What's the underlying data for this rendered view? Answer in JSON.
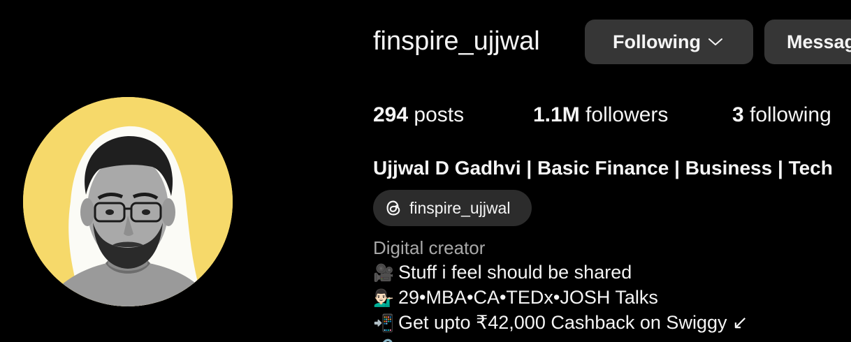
{
  "profile": {
    "username": "finspire_ujjwal",
    "full_name": "Ujjwal D Gadhvi | Basic Finance | Business | Tech",
    "category": "Digital creator"
  },
  "actions": {
    "following_label": "Following",
    "message_label": "Messag"
  },
  "stats": {
    "posts_count": "294",
    "posts_label": "posts",
    "followers_count": "1.1M",
    "followers_label": "followers",
    "following_count": "3",
    "following_label": "following"
  },
  "threads": {
    "handle": "finspire_ujjwal",
    "icon": "threads-icon"
  },
  "bio": {
    "lines": [
      {
        "emoji": "🎥",
        "text": "Stuff i feel should be shared"
      },
      {
        "emoji": "💁🏻‍♂️",
        "text": "29•MBA•CA•TEDx•JOSH Talks"
      },
      {
        "emoji": "📲",
        "text": "Get upto ₹42,000 Cashback on Swiggy ↙"
      },
      {
        "emoji": "🔗",
        "text": ""
      }
    ]
  },
  "colors": {
    "background": "#000000",
    "button_bg": "#363636",
    "pill_bg": "#2c2c2c",
    "avatar_bg": "#f6d96a",
    "muted_text": "#a8a8a8"
  }
}
